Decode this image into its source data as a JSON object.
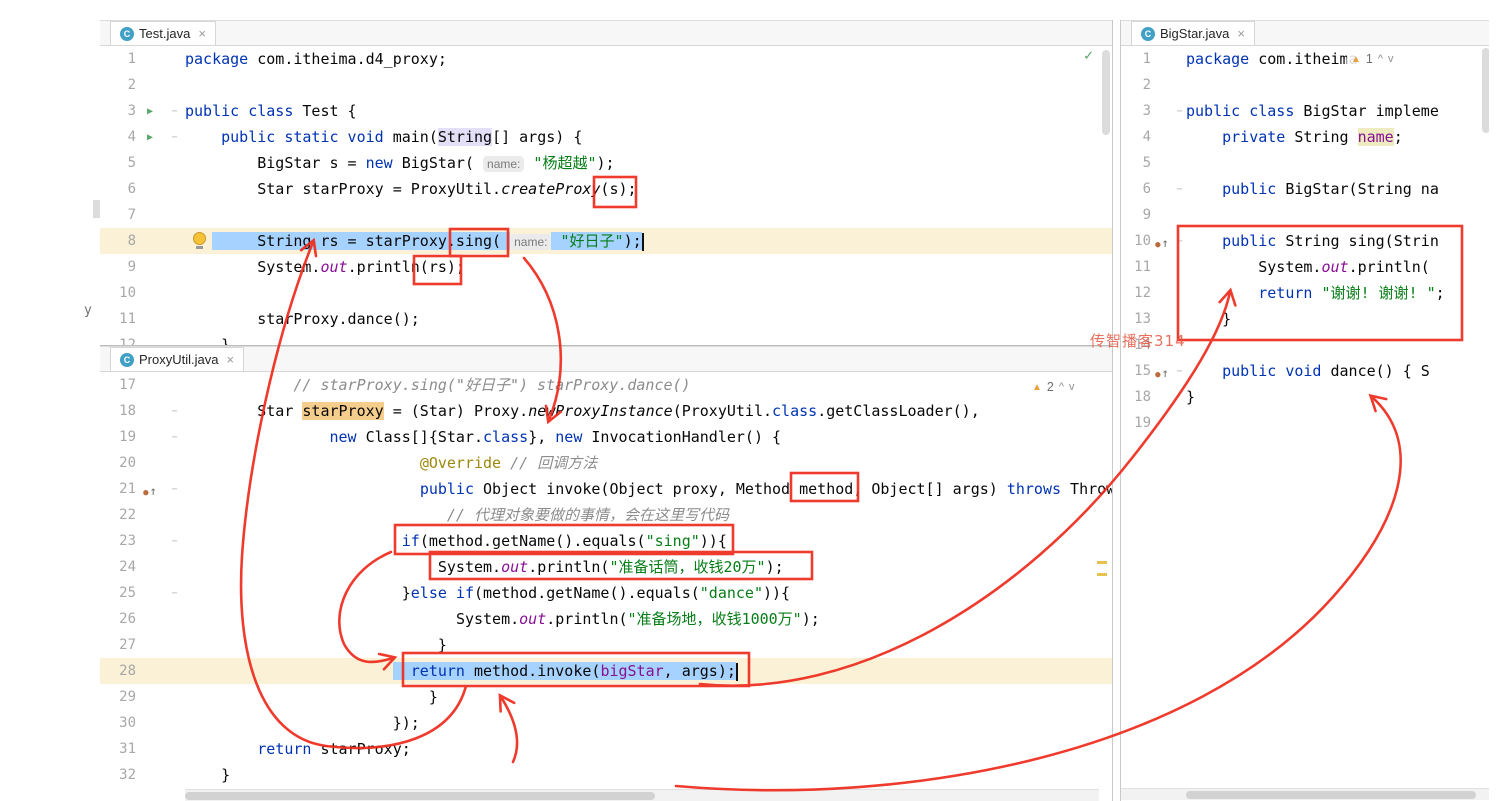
{
  "watermark": "传智播客314",
  "artifacts": {
    "left_text": "y 11"
  },
  "colors": {
    "annotation_red": "#EE2B1C",
    "selection": "#A6D2FF",
    "caret_line": "#FAF1D6",
    "keyword": "#0033B3",
    "string": "#067D17",
    "comment": "#8C8C8C",
    "field": "#871094",
    "annotation": "#9E880D",
    "usage_highlight": "#F5CE8D",
    "declaration_highlight": "#EFEBC0",
    "identifier_highlight": "#E2DFF6",
    "class_icon_bg": "#41A0C6",
    "run_green": "#59A869",
    "warning_yellow": "#E9A13B"
  },
  "icons": {
    "class_badge": "C",
    "run": "▶",
    "overridden_dot": "●",
    "overridden_arrow": "↑",
    "fold": "−",
    "warning": "▲",
    "check": "✓"
  },
  "tabs": {
    "test": {
      "label": "Test.java",
      "close": "×"
    },
    "proxy": {
      "label": "ProxyUtil.java",
      "close": "×"
    },
    "bigstar": {
      "label": "BigStar.java",
      "close": "×"
    }
  },
  "widgets": {
    "proxy_warning": {
      "count": "2",
      "up": "^",
      "down": "v"
    },
    "bigstar_warning": {
      "count": "1",
      "up": "^",
      "down": "v"
    }
  },
  "panes": {
    "test": {
      "lines": [
        {
          "n": "1",
          "seg": [
            [
              "package",
              "kw"
            ],
            [
              " com.itheima.d4_proxy;",
              ""
            ]
          ]
        },
        {
          "n": "2",
          "seg": []
        },
        {
          "n": "3",
          "gut": "run",
          "fold": true,
          "seg": [
            [
              "public class",
              "kw"
            ],
            [
              " Test {",
              ""
            ]
          ]
        },
        {
          "n": "4",
          "gut": "run",
          "fold": true,
          "seg": [
            [
              "    ",
              ""
            ],
            [
              "public static void",
              "kw"
            ],
            [
              " main(",
              ""
            ],
            [
              "String",
              "hl-lav"
            ],
            [
              "[] args) {",
              ""
            ]
          ]
        },
        {
          "n": "5",
          "seg": [
            [
              "        BigStar s = ",
              ""
            ],
            [
              "new",
              "kw"
            ],
            [
              " BigStar( ",
              ""
            ],
            [
              "name:",
              "hint"
            ],
            [
              " ",
              ""
            ],
            [
              "\"杨超越\"",
              "str"
            ],
            [
              ");",
              ""
            ]
          ]
        },
        {
          "n": "6",
          "seg": [
            [
              "        Star starProxy = ProxyUtil.",
              ""
            ],
            [
              "createProxy",
              "sm"
            ],
            [
              "(s);",
              ""
            ]
          ]
        },
        {
          "n": "7",
          "seg": []
        },
        {
          "n": "8",
          "row": true,
          "seg": [
            [
              "   ",
              ""
            ],
            [
              "     String rs = starProxy.sing( ",
              "sel"
            ],
            [
              "name:",
              "hint"
            ],
            [
              " ",
              "sel"
            ],
            [
              "\"好日子\"",
              "str sel"
            ],
            [
              ");",
              "sel"
            ],
            [
              "",
              "caret"
            ]
          ]
        },
        {
          "n": "9",
          "seg": [
            [
              "        System.",
              ""
            ],
            [
              "out",
              "sfld"
            ],
            [
              ".println(rs);",
              ""
            ]
          ]
        },
        {
          "n": "10",
          "seg": []
        },
        {
          "n": "11",
          "seg": [
            [
              "        starProxy.dance();",
              ""
            ]
          ]
        },
        {
          "n": "12",
          "seg": [
            [
              "    }",
              ""
            ]
          ]
        }
      ]
    },
    "proxy": {
      "lines": [
        {
          "n": "17",
          "seg": [
            [
              "            ",
              ""
            ],
            [
              "// starProxy.sing(\"好日子\") starProxy.dance()",
              "cmt"
            ]
          ]
        },
        {
          "n": "18",
          "fold": true,
          "seg": [
            [
              "        Star ",
              ""
            ],
            [
              "starProxy",
              "hl-tan"
            ],
            [
              " = (Star) Proxy.",
              ""
            ],
            [
              "newProxyInstance",
              "sm"
            ],
            [
              "(ProxyUtil.",
              ""
            ],
            [
              "class",
              "kw"
            ],
            [
              ".getClassLoader(),",
              ""
            ]
          ]
        },
        {
          "n": "19",
          "fold": true,
          "seg": [
            [
              "                ",
              ""
            ],
            [
              "new",
              "kw"
            ],
            [
              " Class[]{Star.",
              ""
            ],
            [
              "class",
              "kw"
            ],
            [
              "}, ",
              ""
            ],
            [
              "new",
              "kw"
            ],
            [
              " InvocationHandler() {",
              ""
            ]
          ]
        },
        {
          "n": "20",
          "seg": [
            [
              "                          ",
              ""
            ],
            [
              "@Override",
              "ann"
            ],
            [
              " ",
              ""
            ],
            [
              "// 回调方法",
              "cmt"
            ]
          ]
        },
        {
          "n": "21",
          "gut": "ovr",
          "fold": true,
          "seg": [
            [
              "                          ",
              ""
            ],
            [
              "public",
              "kw"
            ],
            [
              " Object invoke(Object proxy, Method method, Object[] args) ",
              ""
            ],
            [
              "throws",
              "kw"
            ],
            [
              " Throwab",
              ""
            ]
          ]
        },
        {
          "n": "22",
          "seg": [
            [
              "                             ",
              ""
            ],
            [
              "// 代理对象要做的事情，会在这里写代码",
              "cmt"
            ]
          ]
        },
        {
          "n": "23",
          "fold": true,
          "seg": [
            [
              "                        ",
              ""
            ],
            [
              "if",
              "kw"
            ],
            [
              "(method.getName().equals(",
              ""
            ],
            [
              "\"sing\"",
              "str"
            ],
            [
              ")){",
              ""
            ]
          ]
        },
        {
          "n": "24",
          "seg": [
            [
              "                            ",
              ""
            ],
            [
              "System.",
              ""
            ],
            [
              "out",
              "sfld"
            ],
            [
              ".println(",
              ""
            ],
            [
              "\"准备话筒，收钱20万\"",
              "str"
            ],
            [
              ");",
              ""
            ]
          ]
        },
        {
          "n": "25",
          "fold": true,
          "seg": [
            [
              "                        ",
              ""
            ],
            [
              "}",
              ""
            ],
            [
              "else if",
              "kw"
            ],
            [
              "(method.getName().equals(",
              ""
            ],
            [
              "\"dance\"",
              "str"
            ],
            [
              ")){",
              ""
            ]
          ]
        },
        {
          "n": "26",
          "seg": [
            [
              "                              ",
              ""
            ],
            [
              "System.",
              ""
            ],
            [
              "out",
              "sfld"
            ],
            [
              ".println(",
              ""
            ],
            [
              "\"准备场地，收钱1000万\"",
              "str"
            ],
            [
              ");",
              ""
            ]
          ]
        },
        {
          "n": "27",
          "seg": [
            [
              "                            ",
              ""
            ],
            [
              "}",
              ""
            ]
          ]
        },
        {
          "n": "28",
          "row": true,
          "seg": [
            [
              "                       ",
              ""
            ],
            [
              "  ",
              "sel"
            ],
            [
              "return",
              "kw sel"
            ],
            [
              " method.invoke(",
              "sel"
            ],
            [
              "bigStar",
              "fld sel"
            ],
            [
              ", args);",
              "sel"
            ],
            [
              "",
              "caret"
            ]
          ]
        },
        {
          "n": "29",
          "seg": [
            [
              "                           ",
              ""
            ],
            [
              "}",
              ""
            ]
          ]
        },
        {
          "n": "30",
          "seg": [
            [
              "                       ",
              ""
            ],
            [
              "});",
              ""
            ]
          ]
        },
        {
          "n": "31",
          "seg": [
            [
              "        ",
              ""
            ],
            [
              "return",
              "kw"
            ],
            [
              " starProxy;",
              ""
            ]
          ]
        },
        {
          "n": "32",
          "seg": [
            [
              "    }",
              ""
            ]
          ]
        }
      ]
    },
    "bigstar": {
      "lines": [
        {
          "n": "1",
          "seg": [
            [
              "package",
              "kw"
            ],
            [
              " com.itheima",
              ""
            ]
          ]
        },
        {
          "n": "2",
          "seg": []
        },
        {
          "n": "3",
          "fold": true,
          "seg": [
            [
              "public class",
              "kw"
            ],
            [
              " BigStar impleme",
              ""
            ]
          ]
        },
        {
          "n": "4",
          "seg": [
            [
              "    ",
              ""
            ],
            [
              "private",
              "kw"
            ],
            [
              " String ",
              ""
            ],
            [
              "name",
              "fld hl-name"
            ],
            [
              ";",
              ""
            ]
          ]
        },
        {
          "n": "5",
          "seg": []
        },
        {
          "n": "6",
          "fold": true,
          "seg": [
            [
              "    ",
              ""
            ],
            [
              "public",
              "kw"
            ],
            [
              " BigStar(String na",
              ""
            ]
          ]
        },
        {
          "n": "9",
          "seg": []
        },
        {
          "n": "10",
          "gut": "ovr",
          "fold": true,
          "seg": [
            [
              "    ",
              ""
            ],
            [
              "public",
              "kw"
            ],
            [
              " String sing(Strin",
              ""
            ]
          ]
        },
        {
          "n": "11",
          "seg": [
            [
              "        System.",
              ""
            ],
            [
              "out",
              "sfld"
            ],
            [
              ".println(",
              ""
            ]
          ]
        },
        {
          "n": "12",
          "seg": [
            [
              "        ",
              ""
            ],
            [
              "return",
              "kw"
            ],
            [
              " ",
              ""
            ],
            [
              "\"谢谢! 谢谢! \"",
              "str"
            ],
            [
              ";",
              ""
            ]
          ]
        },
        {
          "n": "13",
          "seg": [
            [
              "    }",
              ""
            ]
          ]
        },
        {
          "n": "14",
          "seg": []
        },
        {
          "n": "15",
          "gut": "ovr",
          "fold": true,
          "seg": [
            [
              "    ",
              ""
            ],
            [
              "public void",
              "kw"
            ],
            [
              " dance() { S",
              ""
            ]
          ]
        },
        {
          "n": "18",
          "seg": [
            [
              "}",
              ""
            ]
          ]
        },
        {
          "n": "19",
          "seg": []
        }
      ]
    }
  }
}
